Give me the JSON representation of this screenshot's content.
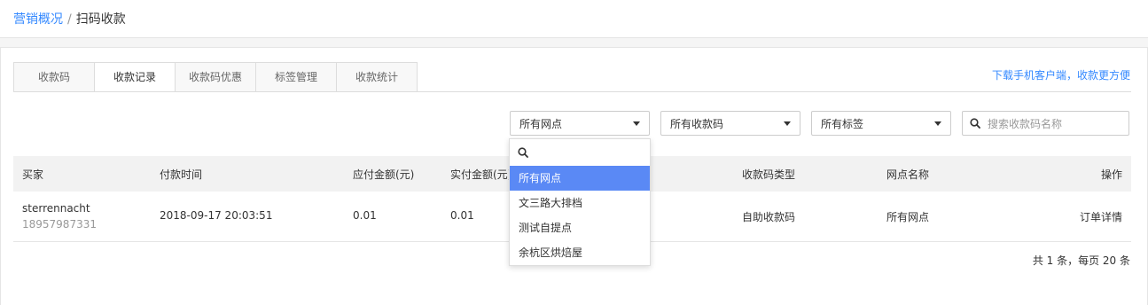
{
  "breadcrumb": {
    "parent": "营销概况",
    "separator": "/",
    "current": "扫码收款"
  },
  "tabs": [
    "收款码",
    "收款记录",
    "收款码优惠",
    "标签管理",
    "收款统计"
  ],
  "active_tab": "收款记录",
  "download_link": "下载手机客户端，收款更方便",
  "filters": {
    "outlet": "所有网点",
    "qrcode": "所有收款码",
    "tag": "所有标签",
    "search_placeholder": "搜索收款码名称"
  },
  "table": {
    "headers": [
      "买家",
      "付款时间",
      "应付金额(元)",
      "实付金额(元)",
      "收款码类型",
      "网点名称",
      "操作"
    ],
    "rows": [
      {
        "buyer_name": "sterrennacht",
        "buyer_phone": "18957987331",
        "pay_time": "2018-09-17 20:03:51",
        "amount_due": "0.01",
        "amount_paid": "0.01",
        "qrcode_type": "自助收款码",
        "outlet": "所有网点",
        "action": "订单详情"
      }
    ]
  },
  "pagination": "共 1 条，每页 20 条",
  "dropdown": {
    "search_placeholder": "",
    "options": [
      "所有网点",
      "文三路大排档",
      "测试自提点",
      "余杭区烘焙屋"
    ],
    "selected": "所有网点"
  },
  "colors": {
    "accent": "#3388ff",
    "selected_option": "#5a89f5"
  }
}
